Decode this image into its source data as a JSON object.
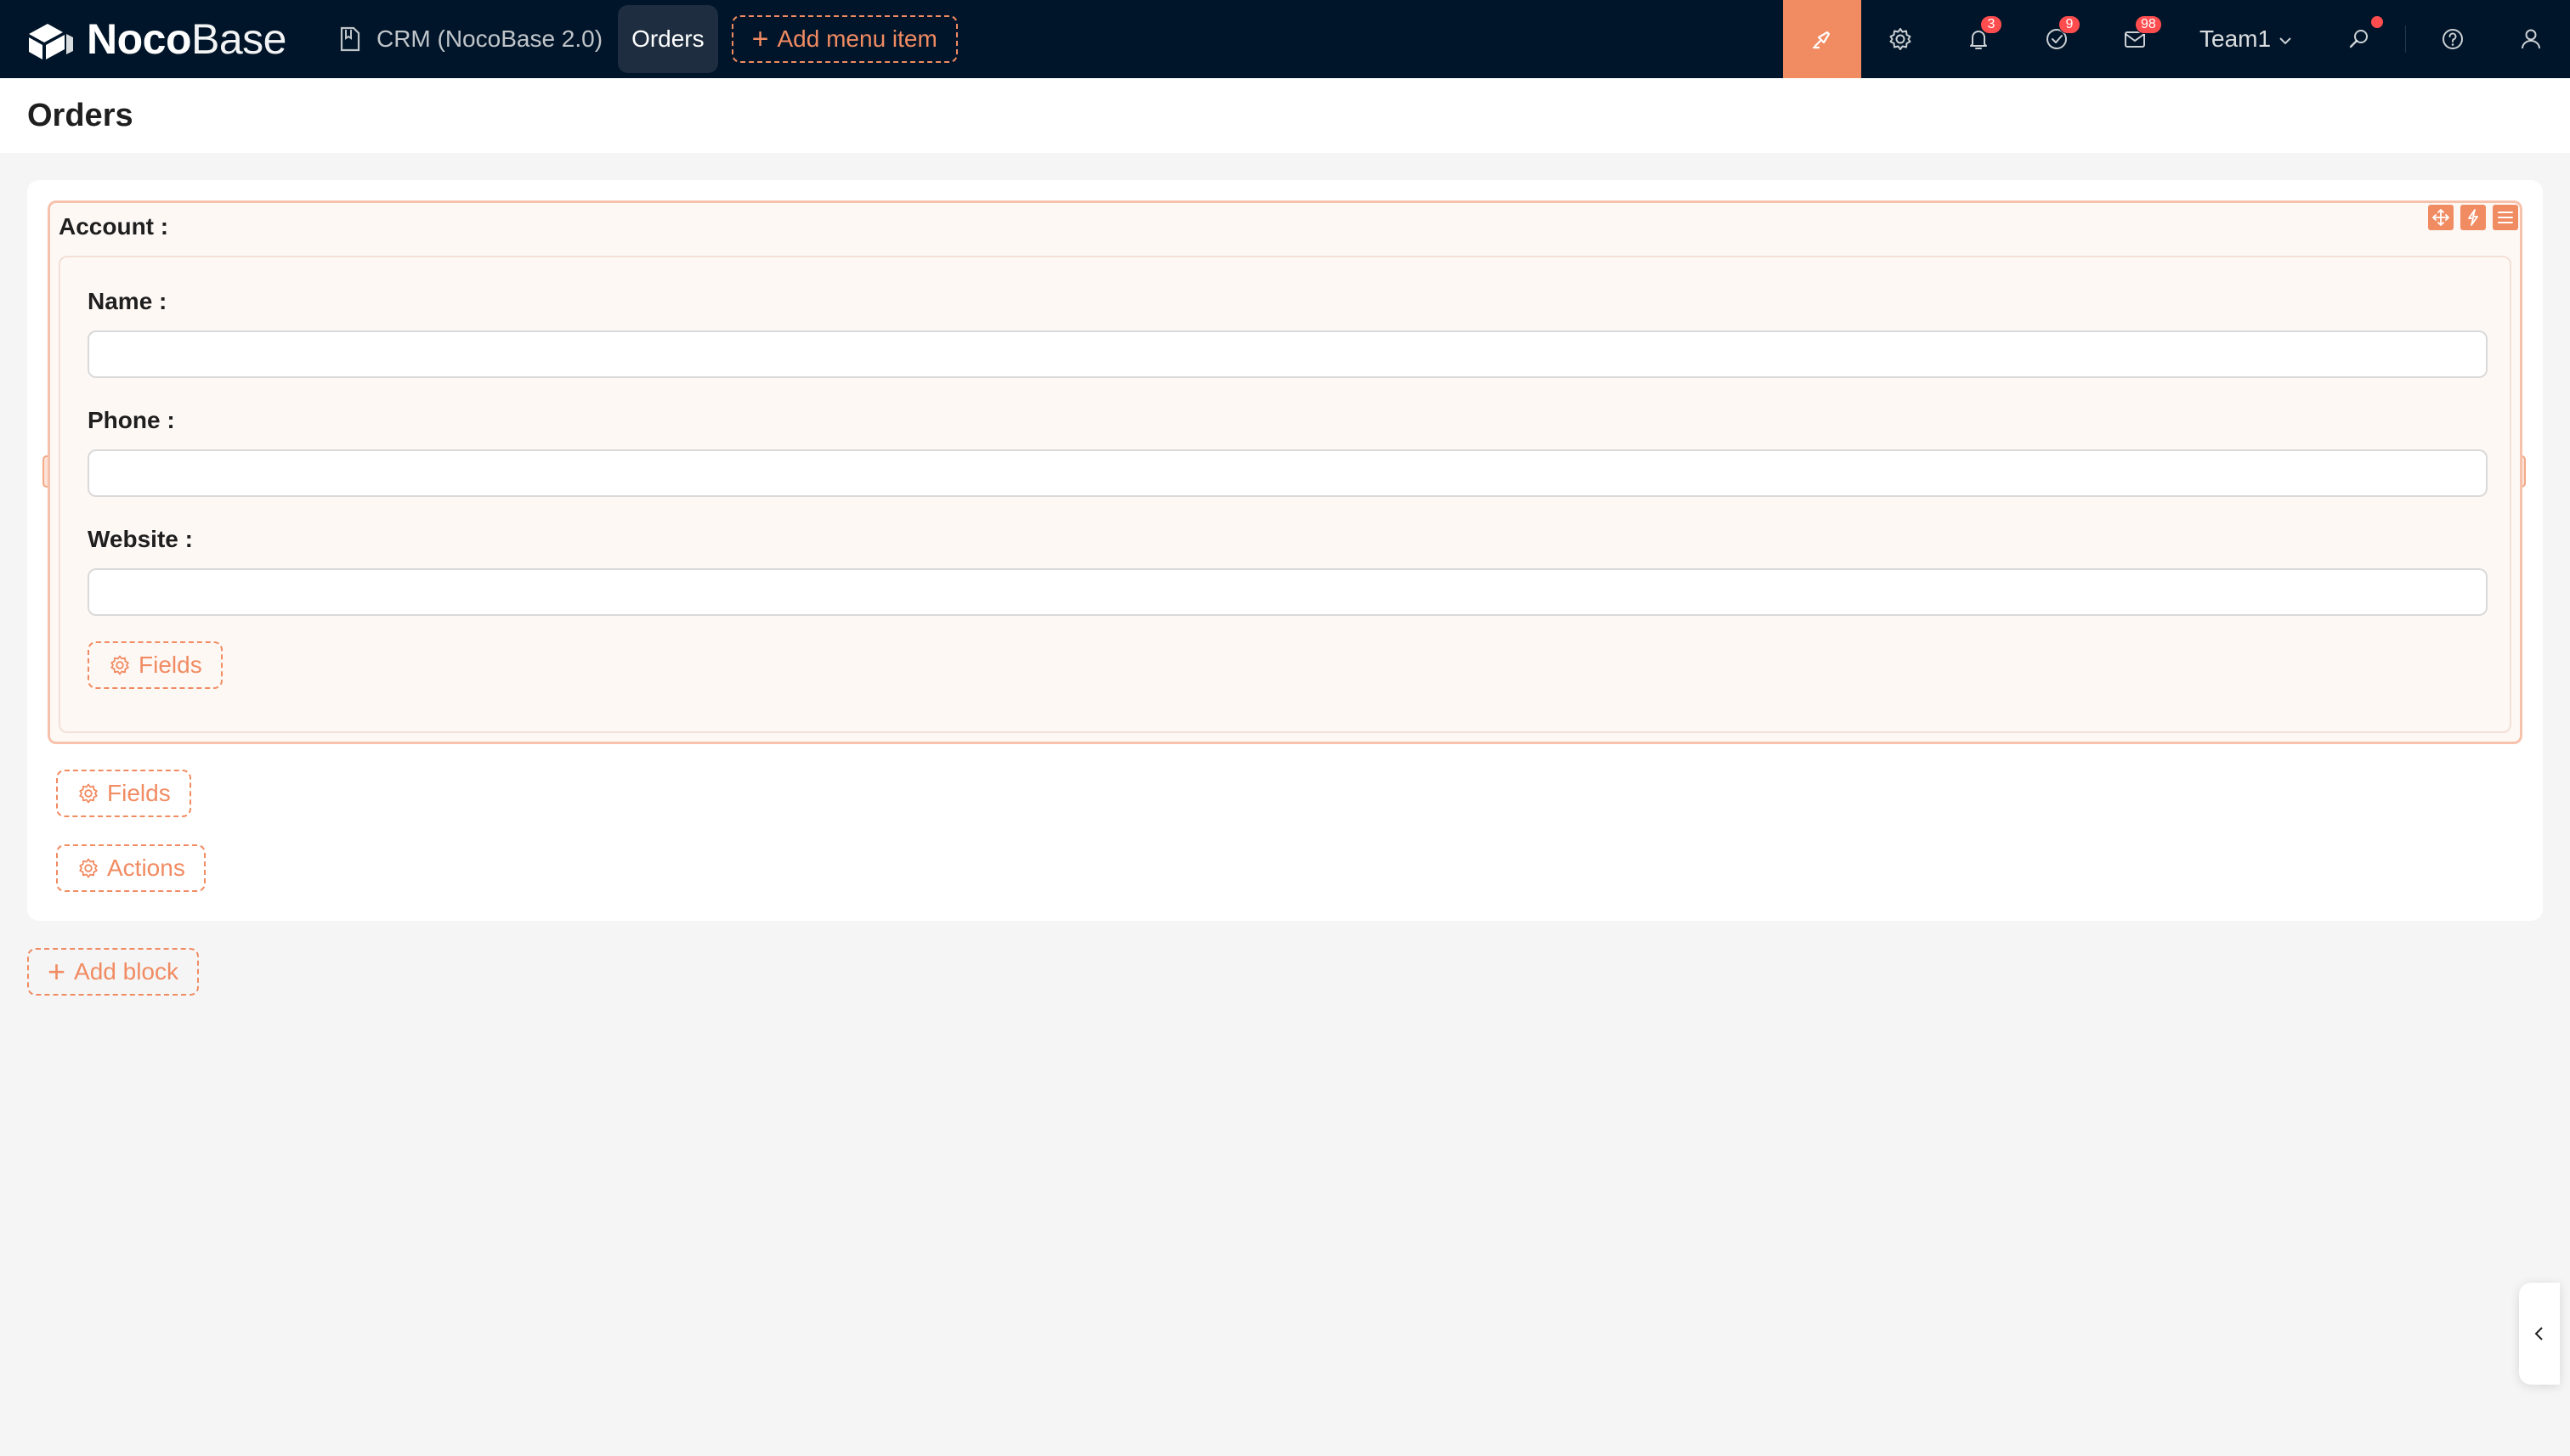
{
  "app": {
    "logo_bold": "Noco",
    "logo_light": "Base"
  },
  "topbar": {
    "menu": [
      {
        "label": "CRM (NocoBase 2.0)",
        "icon": "document-icon"
      },
      {
        "label": "Orders",
        "active": true
      }
    ],
    "add_menu_item_label": "Add menu item",
    "right_icons": [
      {
        "name": "ui-editor-icon",
        "active": true
      },
      {
        "name": "settings-icon"
      },
      {
        "name": "bell-icon",
        "badge": "3"
      },
      {
        "name": "task-check-icon",
        "badge": "9"
      },
      {
        "name": "mail-icon",
        "badge": "98"
      }
    ],
    "team_label": "Team1",
    "after_team_icons": [
      {
        "name": "search-icon",
        "dot": true
      },
      {
        "name": "help-icon"
      },
      {
        "name": "user-icon"
      }
    ]
  },
  "page": {
    "title": "Orders"
  },
  "form": {
    "association_label": "Account :",
    "fields": [
      {
        "label": "Name :",
        "value": ""
      },
      {
        "label": "Phone :",
        "value": ""
      },
      {
        "label": "Website :",
        "value": ""
      }
    ],
    "inner_fields_button": "Fields",
    "outer_fields_button": "Fields",
    "actions_button": "Actions"
  },
  "add_block_label": "Add block",
  "colors": {
    "accent": "#f18b62",
    "topbar": "#001529",
    "badge": "#ff4d4f"
  }
}
